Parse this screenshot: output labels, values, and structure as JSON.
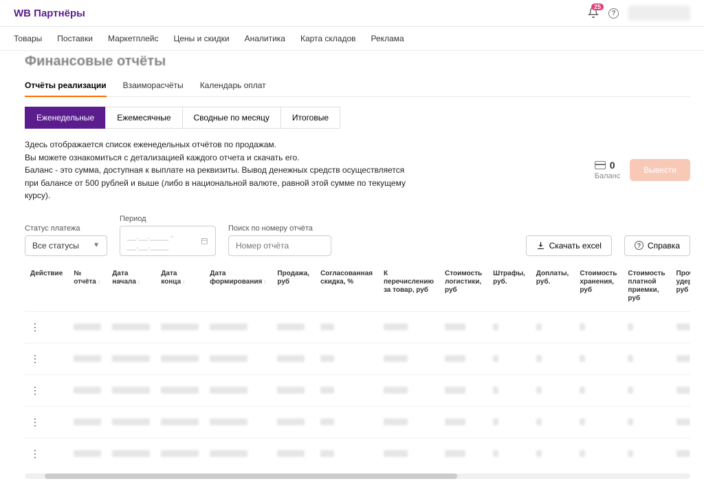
{
  "brand": "WB Партнёры",
  "notifications": {
    "count": "25"
  },
  "nav": [
    "Товары",
    "Поставки",
    "Маркетплейс",
    "Цены и скидки",
    "Аналитика",
    "Карта складов",
    "Реклама"
  ],
  "page_title": "Финансовые отчёты",
  "tabs": {
    "items": [
      "Отчёты реализации",
      "Взаиморасчёты",
      "Календарь оплат"
    ],
    "active": 0
  },
  "subtabs": {
    "items": [
      "Еженедельные",
      "Ежемесячные",
      "Сводные по месяцу",
      "Итоговые"
    ],
    "active": 0
  },
  "description": {
    "l1": "Здесь отображается список еженедельных отчётов по продажам.",
    "l2": "Вы можете ознакомиться с детализацией каждого отчета и скачать его.",
    "l3": "Баланс - это сумма, доступная к выплате на реквизиты. Вывод денежных средств осуществляется при балансе от 500 рублей и выше (либо в национальной валюте, равной этой сумме по текущему курсу)."
  },
  "balance": {
    "value": "0",
    "label": "Баланс",
    "withdraw": "Вывести"
  },
  "filters": {
    "status_label": "Статус платежа",
    "status_value": "Все статусы",
    "period_label": "Период",
    "period_placeholder": "__.__.____ - __.__.____",
    "search_label": "Поиск по номеру отчёта",
    "search_placeholder": "Номер отчёта"
  },
  "actions": {
    "download": "Скачать excel",
    "help": "Справка"
  },
  "columns": [
    "Действие",
    "№ отчёта",
    "Дата начала",
    "Дата конца",
    "Дата формирования",
    "Продажа, руб",
    "Согласованная скидка, %",
    "К перечислению за товар, руб",
    "Стоимость логистики, руб",
    "Штрафы, руб.",
    "Доплаты, руб.",
    "Стоимость хранения, руб",
    "Стоимость платной приемки, руб",
    "Прочие удержания, руб"
  ],
  "sortable_cols": [
    1,
    2,
    3,
    4
  ],
  "rows": 5
}
